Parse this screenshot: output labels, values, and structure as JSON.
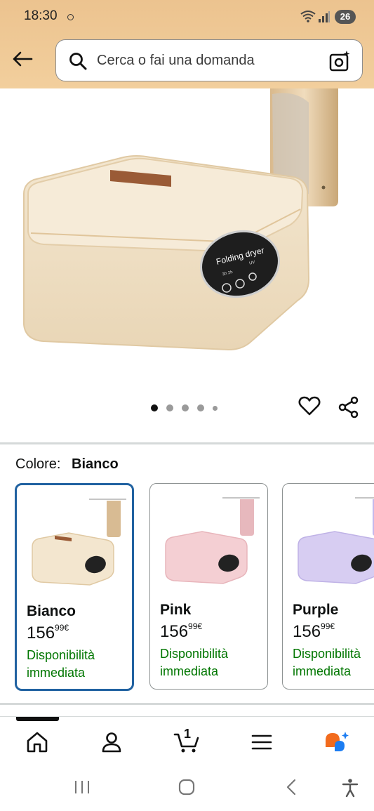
{
  "status_bar": {
    "time": "18:30",
    "battery": "26"
  },
  "search": {
    "placeholder": "Cerca o fai una domanda"
  },
  "product": {
    "device_label": "Folding dryer",
    "panel_labels": [
      "3h 2h",
      "UV"
    ],
    "image_count": 5,
    "active_image": 1
  },
  "color_selector": {
    "label": "Colore:",
    "selected": "Bianco",
    "options": [
      {
        "name": "Bianco",
        "price_whole": "156",
        "price_fraction": "99",
        "currency": "€",
        "availability": "Disponibilità immediata",
        "color": "#f3e6cf"
      },
      {
        "name": "Pink",
        "price_whole": "156",
        "price_fraction": "99",
        "currency": "€",
        "availability": "Disponibilità immediata",
        "color": "#f4cfd3"
      },
      {
        "name": "Purple",
        "price_whole": "156",
        "price_fraction": "99",
        "currency": "€",
        "availability": "Disponibilità immediata",
        "color": "#d7cdf2"
      }
    ]
  },
  "bottom_nav": {
    "cart_count": "1",
    "items": [
      "home-icon",
      "account-icon",
      "cart-icon",
      "menu-icon",
      "rufus-ai-icon"
    ]
  },
  "colors": {
    "header_bg": "#ecc38f",
    "selected_border": "#2162a1",
    "availability": "#007600"
  }
}
